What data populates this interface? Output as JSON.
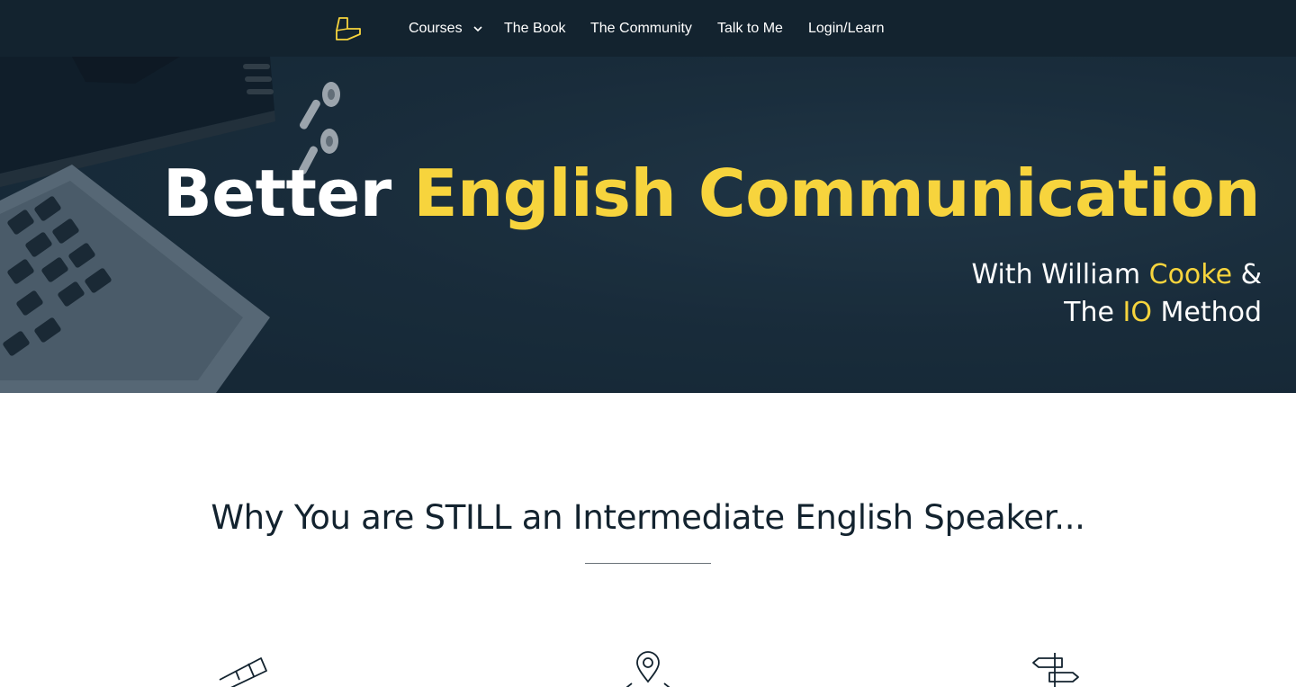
{
  "nav": {
    "logo_icon": "io-method-logo-icon",
    "items": [
      {
        "label": "Courses",
        "has_dropdown": true
      },
      {
        "label": "The Book"
      },
      {
        "label": "The Community"
      },
      {
        "label": "Talk to Me"
      },
      {
        "label": "Login/Learn"
      }
    ]
  },
  "hero": {
    "title_white": "Better",
    "title_yellow": "English Communication",
    "sub_line1_a": "With William",
    "sub_line1_b": "Cooke",
    "sub_line1_c": "&",
    "sub_line2_a": "The",
    "sub_line2_b": "IO",
    "sub_line2_c": "Method"
  },
  "section": {
    "title": "Why You are STILL an Intermediate English Speaker..."
  },
  "features": {
    "icons": [
      "telescope-icon",
      "location-pin-map-icon",
      "signpost-icon"
    ]
  },
  "colors": {
    "nav_bg": "#13232f",
    "accent_yellow": "#f7d43d",
    "hero_bg": "#1b2e3b",
    "heading_text": "#13232f"
  }
}
